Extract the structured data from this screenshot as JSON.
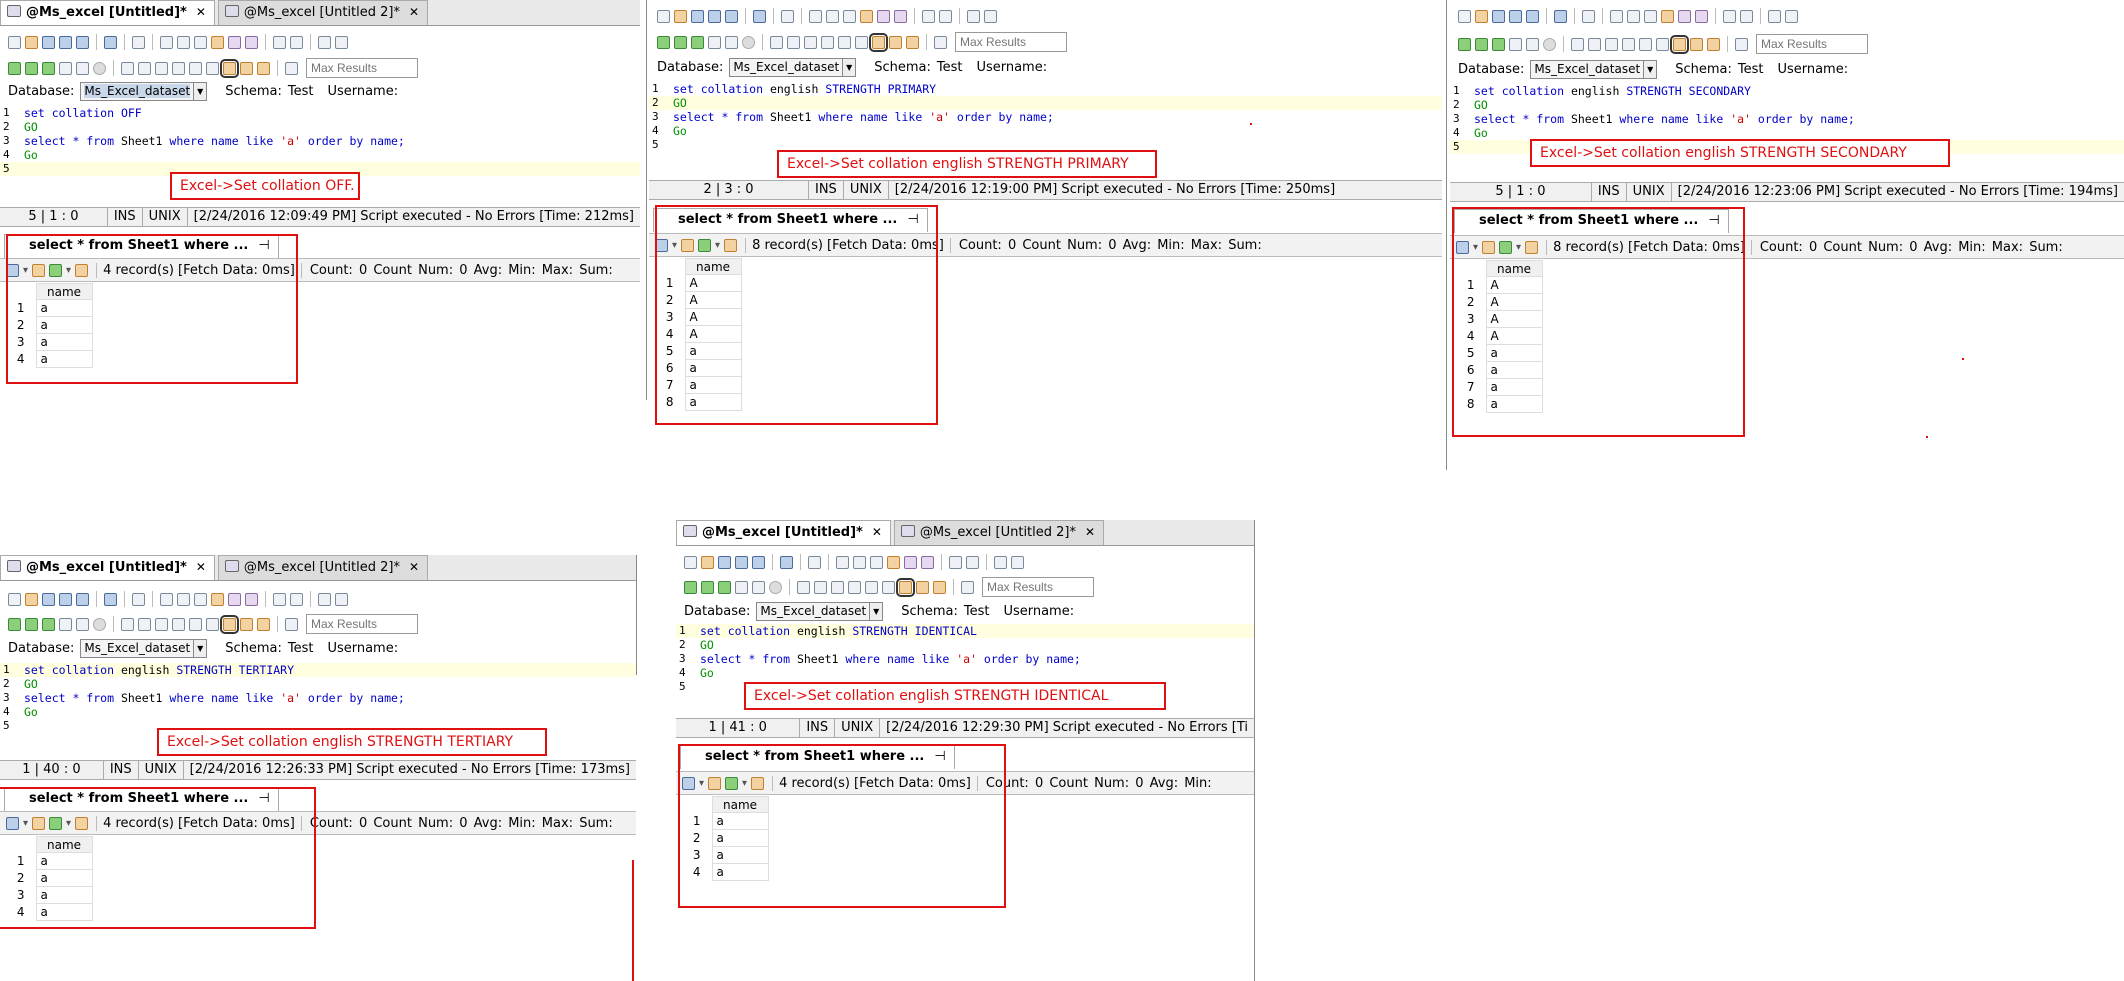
{
  "tabs": {
    "untitled": "@Ms_excel [Untitled]*",
    "untitled2": "@Ms_excel [Untitled 2]*",
    "close": "✕"
  },
  "toolbar": {
    "max_results_placeholder": "Max Results"
  },
  "db": {
    "database_label": "Database:",
    "database_value": "Ms_Excel_dataset",
    "schema_label": "Schema:",
    "schema_value": "Test",
    "username_label": "Username:"
  },
  "line_numbers": [
    "1",
    "2",
    "3",
    "4",
    "5"
  ],
  "sql": {
    "go_upper": "GO",
    "go_mixed": "Go",
    "select_kw": "select",
    "star_from": " * from ",
    "table": "Sheet1",
    "where": " where ",
    "name_col": "name",
    "like": " like ",
    "literal": "'a'",
    "orderby": " order by ",
    "name_end": "name;",
    "set_collation": "set collation",
    "english": " english ",
    "off": " OFF",
    "primary": "STRENGTH PRIMARY",
    "secondary": "STRENGTH SECONDARY",
    "tertiary": "STRENGTH TERTIARY",
    "identical": "STRENGTH IDENTICAL"
  },
  "panels": [
    {
      "id": "off",
      "note": "Excel->Set collation OFF.",
      "status_pos": "5 | 1 : 0",
      "status_msg": "[2/24/2016 12:09:49 PM] Script executed - No Errors [Time: 212ms]",
      "result_tab": "select * from Sheet1 where ...",
      "records": "4 record(s) [Fetch Data: 0ms]",
      "counts": "Count: 0  Count Num: 0  Avg:  Min:  Max:  Sum:",
      "rows": [
        "a",
        "a",
        "a",
        "a"
      ]
    },
    {
      "id": "primary",
      "note": "Excel->Set collation english STRENGTH PRIMARY",
      "status_pos": "2 | 3 : 0",
      "status_msg": "[2/24/2016 12:19:00 PM] Script executed - No Errors [Time: 250ms]",
      "result_tab": "select * from Sheet1 where ...",
      "records": "8 record(s) [Fetch Data: 0ms]",
      "counts": "Count: 0  Count Num: 0  Avg:  Min:  Max:  Sum:",
      "rows": [
        "A",
        "A",
        "A",
        "A",
        "a",
        "a",
        "a",
        "a"
      ]
    },
    {
      "id": "secondary",
      "note": "Excel->Set collation english STRENGTH SECONDARY",
      "status_pos": "5 | 1 : 0",
      "status_msg": "[2/24/2016 12:23:06 PM] Script executed - No Errors [Time: 194ms]",
      "result_tab": "select * from Sheet1 where ...",
      "records": "8 record(s) [Fetch Data: 0ms]",
      "counts": "Count: 0  Count Num: 0  Avg:  Min:  Max:  Sum:",
      "rows": [
        "A",
        "A",
        "A",
        "A",
        "a",
        "a",
        "a",
        "a"
      ]
    },
    {
      "id": "tertiary",
      "note": "Excel->Set collation english STRENGTH TERTIARY",
      "status_pos": "1 | 40 : 0",
      "status_msg": "[2/24/2016 12:26:33 PM] Script executed - No Errors [Time: 173ms]",
      "result_tab": "select * from Sheet1 where ...",
      "records": "4 record(s) [Fetch Data: 0ms]",
      "counts": "Count: 0  Count Num: 0  Avg:  Min:  Max:  Sum:",
      "rows": [
        "a",
        "a",
        "a",
        "a"
      ]
    },
    {
      "id": "identical",
      "note": "Excel->Set collation english STRENGTH IDENTICAL",
      "status_pos": "1 | 41 : 0",
      "status_msg": "[2/24/2016 12:29:30 PM] Script executed - No Errors [Ti",
      "result_tab": "select * from Sheet1 where ...",
      "records": "4 record(s) [Fetch Data: 0ms]",
      "counts": "Count: 0  Count Num: 0  Avg:  Min:",
      "rows": [
        "a",
        "a",
        "a",
        "a"
      ]
    }
  ],
  "ins": "INS",
  "unix": "UNIX",
  "col_header": "name",
  "pin_icon": "⊣"
}
